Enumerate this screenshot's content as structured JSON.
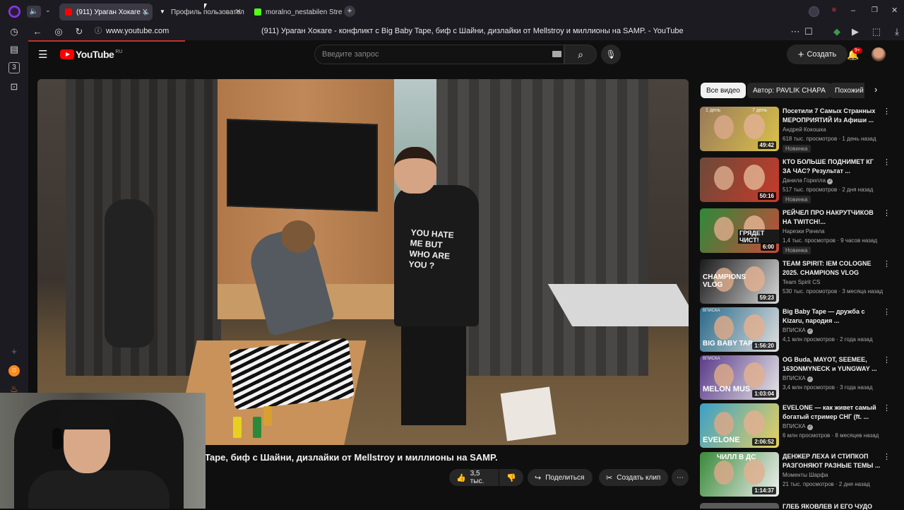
{
  "browser": {
    "tabs": [
      {
        "label": "(911) Ураган Хокаге",
        "color": "#ff0000"
      },
      {
        "label": "Профиль пользовател",
        "color": "#ffffff"
      },
      {
        "label": "moralno_nestabilen Stream",
        "color": "#53fc18"
      }
    ],
    "url": "www.youtube.com",
    "page_title": "(911) Ураган Хокаге - конфликт с Big Baby Tape, биф с Шайни, дизлайки от Mellstroy и миллионы на SAMP. - YouTube"
  },
  "sidebar": {
    "workspace_number": "3"
  },
  "youtube": {
    "logo_text": "YouTube",
    "region": "RU",
    "search_placeholder": "Введите запрос",
    "create_label": "Создать",
    "notif_count": "9+",
    "video_title": "Tape, биф с Шайни, дизлайки от Mellstroy и миллионы на SAMP.",
    "likes": "3,5 тыс.",
    "share_label": "Поделиться",
    "clip_label": "Создать клип",
    "chips": [
      "Все видео",
      "Автор: PAVLIK CHAPA",
      "Похожий"
    ],
    "recommendations": [
      {
        "title": "Посетили 7 Самых Странных МЕРОПРИЯТИЙ Из Афиши ...",
        "channel": "Андрей Кокошка",
        "meta": "618 тыс. просмотров · 1 день назад",
        "badge": "Новинка",
        "duration": "49:42",
        "verified": false,
        "thumb": [
          "#9a7a5a",
          "#d9c24a"
        ]
      },
      {
        "title": "КТО БОЛЬШЕ ПОДНИМЕТ КГ ЗА ЧАС? Результат ...",
        "channel": "Данила Горилла",
        "meta": "517 тыс. просмотров · 2 дня назад",
        "badge": "Новинка",
        "duration": "50:16",
        "verified": true,
        "thumb": [
          "#6a4a3a",
          "#c83a2a"
        ]
      },
      {
        "title": "РЕЙЧЕЛ ПРО НАКРУТЧИКОВ НА TWITCH!...",
        "channel": "Нарезки Рачела",
        "meta": "1,4 тыс. просмотров · 9 часов назад",
        "badge": "Новинка",
        "duration": "6:00",
        "verified": false,
        "thumb": [
          "#2d8a3a",
          "#c64a3a"
        ]
      },
      {
        "title": "TEAM SPIRIT: IEM COLOGNE 2025. CHAMPIONS VLOG",
        "channel": "Team Spirit CS",
        "meta": "530 тыс. просмотров · 3 месяца назад",
        "badge": "",
        "duration": "59:23",
        "verified": false,
        "thumb": [
          "#1a1a1a",
          "#d8d8d8"
        ]
      },
      {
        "title": "Big Baby Tape — дружба с Kizaru, пародия ...",
        "channel": "ВПИСКА",
        "meta": "4,1 млн просмотров · 2 года назад",
        "badge": "",
        "duration": "1:56:20",
        "verified": true,
        "thumb": [
          "#2a6a8a",
          "#e0e0e0"
        ]
      },
      {
        "title": "OG Buda, MAYOT, SEEMEE, 163ONMYNECK и YUNGWAY ...",
        "channel": "ВПИСКА",
        "meta": "3,4 млн просмотров · 3 года назад",
        "badge": "",
        "duration": "1:03:04",
        "verified": true,
        "thumb": [
          "#5a3a8a",
          "#e6e6e6"
        ]
      },
      {
        "title": "EVELONE — как живет самый богатый стример СНГ (ft. ...",
        "channel": "ВПИСКА",
        "meta": "6 млн просмотров · 8 месяцев назад",
        "badge": "",
        "duration": "2:06:52",
        "verified": true,
        "thumb": [
          "#3aa0c8",
          "#e8d060"
        ]
      },
      {
        "title": "ДЕНЖЕР ЛЕХА И СТИПКОП РАЗГОНЯЮТ РАЗНЫЕ ТЕМЫ ...",
        "channel": "Моменты Шарфа",
        "meta": "21 тыс. просмотров · 2 дня назад",
        "badge": "",
        "duration": "1:14:37",
        "verified": false,
        "thumb": [
          "#3a8a3a",
          "#f0f0f0"
        ]
      }
    ],
    "thumb_texts": {
      "r1_left": "1 день",
      "r1_right": "7 день",
      "r3": "ГРЯДЕТ ЧИСТ!",
      "r4_big": "CHAMPIONS VLOG",
      "r5_top": "ВПИСКА",
      "r5": "BIG BABY TAP",
      "r6_top": "ВПИСКА",
      "r6": "MELON MUS",
      "r7": "EVELONE",
      "r8": "ЧИЛЛ В ДС"
    },
    "partial_title": "ГЛЕБ ЯКОВЛЕВ И ЕГО ЧУДО",
    "shirt_text": "YOU HATE ME BUT WHO ARE YOU ?"
  }
}
